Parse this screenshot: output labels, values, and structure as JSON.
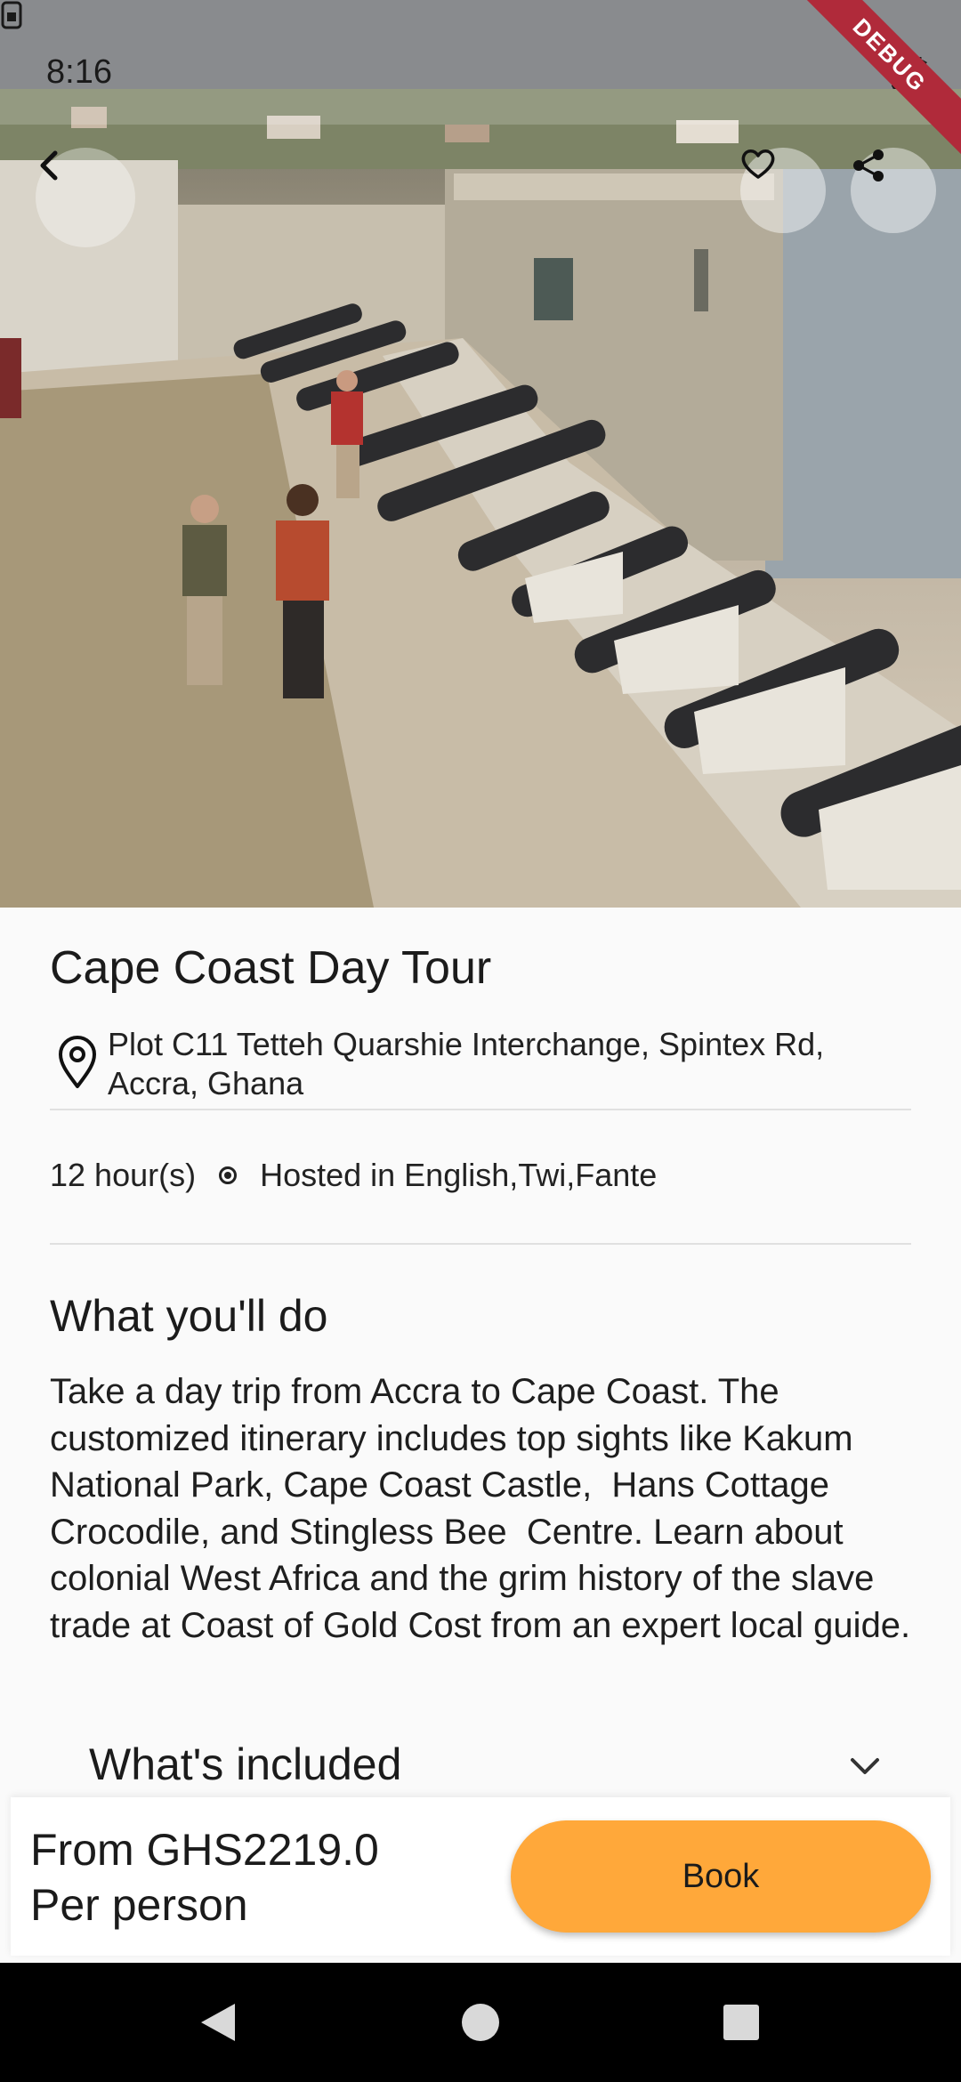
{
  "status_bar": {
    "time": "8:16",
    "debug_label": "DEBUG"
  },
  "header_icons": {
    "back": "chevron-left-icon",
    "favorite": "heart-icon",
    "share": "share-icon"
  },
  "tour": {
    "title": "Cape Coast Day Tour",
    "address": "Plot C11 Tetteh Quarshie Interchange, Spintex Rd, Accra, Ghana",
    "duration": "12 hour(s)",
    "languages": "Hosted in English,Twi,Fante"
  },
  "what_you_do": {
    "heading": "What you'll do",
    "text": "Take a day trip from Accra to Cape Coast. The customized itinerary includes top sights like Kakum National Park, Cape Coast Castle,  Hans Cottage Crocodile, and Stingless Bee  Centre. Learn about colonial West Africa and the grim history of the slave trade at Coast of Gold Cost from an expert local guide."
  },
  "included": {
    "heading": "What's included"
  },
  "booking": {
    "price_line1": "From GHS2219.0",
    "price_line2": "Per person",
    "book_label": "Book"
  },
  "colors": {
    "accent": "#ffa83a",
    "debug": "#b02a3a"
  }
}
